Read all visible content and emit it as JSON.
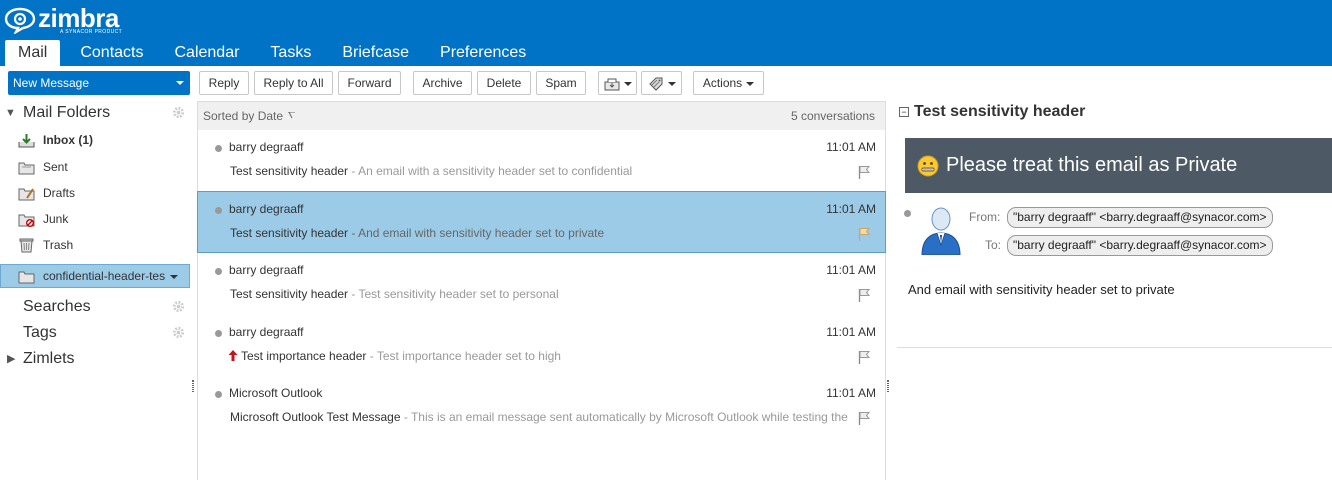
{
  "app": {
    "logo_text": "zimbra",
    "logo_tagline": "A SYNACOR PRODUCT",
    "accent": "#0073c6"
  },
  "tabs": [
    {
      "label": "Mail",
      "active": true
    },
    {
      "label": "Contacts"
    },
    {
      "label": "Calendar"
    },
    {
      "label": "Tasks"
    },
    {
      "label": "Briefcase"
    },
    {
      "label": "Preferences"
    }
  ],
  "toolbar": {
    "new_message": "New Message",
    "reply": "Reply",
    "reply_all": "Reply to All",
    "forward": "Forward",
    "archive": "Archive",
    "delete": "Delete",
    "spam": "Spam",
    "actions": "Actions"
  },
  "sidebar": {
    "mail_folders": "Mail Folders",
    "folders": [
      {
        "label": "Inbox (1)",
        "icon": "inbox-icon"
      },
      {
        "label": "Sent",
        "icon": "sent-folder-icon"
      },
      {
        "label": "Drafts",
        "icon": "drafts-folder-icon"
      },
      {
        "label": "Junk",
        "icon": "junk-folder-icon"
      },
      {
        "label": "Trash",
        "icon": "trash-icon"
      },
      {
        "label": "confidential-header-tes",
        "icon": "folder-icon",
        "selected": true
      }
    ],
    "searches": "Searches",
    "tags": "Tags",
    "zimlets": "Zimlets"
  },
  "list": {
    "sorted_by": "Sorted by Date",
    "count": "5 conversations",
    "rows": [
      {
        "sender": "barry degraaff",
        "time": "11:01 AM",
        "subject": "Test sensitivity header",
        "fragment": " - An email with a sensitivity header set to confidential"
      },
      {
        "sender": "barry degraaff",
        "time": "11:01 AM",
        "subject": "Test sensitivity header",
        "fragment": " - And email with sensitivity header set to private",
        "selected": true
      },
      {
        "sender": "barry degraaff",
        "time": "11:01 AM",
        "subject": "Test sensitivity header",
        "fragment": " - Test sensitivity header set to personal"
      },
      {
        "sender": "barry degraaff",
        "time": "11:01 AM",
        "subject": "Test importance header",
        "fragment": " - Test importance header set to high",
        "high_importance": true
      },
      {
        "sender": "Microsoft Outlook",
        "time": "11:01 AM",
        "subject": "Microsoft Outlook Test Message",
        "fragment": " - This is an email message sent automatically by Microsoft Outlook while testing the"
      }
    ]
  },
  "reading": {
    "title": "Test sensitivity header",
    "collapse": "⊟",
    "banner": "Please treat this email as Private",
    "from_label": "From:",
    "from_value": "\"barry degraaff\" <barry.degraaff@synacor.com>",
    "to_label": "To:",
    "to_value": "\"barry degraaff\" <barry.degraaff@synacor.com>",
    "body": "And email with sensitivity header set to private"
  }
}
